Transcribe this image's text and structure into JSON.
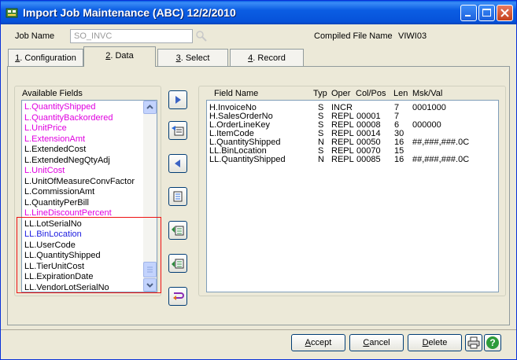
{
  "window": {
    "title": "Import Job Maintenance (ABC) 12/2/2010"
  },
  "header": {
    "job_name_label": "Job Name",
    "job_name_value": "SO_INVC",
    "compiled_label": "Compiled File Name",
    "compiled_value": "VIWI03"
  },
  "tabs": [
    {
      "key": "1",
      "rest": ". Configuration"
    },
    {
      "key": "2",
      "rest": ". Data"
    },
    {
      "key": "3",
      "rest": ". Select"
    },
    {
      "key": "4",
      "rest": ". Record"
    }
  ],
  "available": {
    "header": "Available Fields",
    "items": [
      {
        "label": "L.QuantityShipped",
        "color": "#E000E0"
      },
      {
        "label": "L.QuantityBackordered",
        "color": "#E000E0"
      },
      {
        "label": "L.UnitPrice",
        "color": "#E000E0"
      },
      {
        "label": "L.ExtensionAmt",
        "color": "#E000E0"
      },
      {
        "label": "L.ExtendedCost",
        "color": "#000000"
      },
      {
        "label": "L.ExtendedNegQtyAdj",
        "color": "#000000"
      },
      {
        "label": "L.UnitCost",
        "color": "#E000E0"
      },
      {
        "label": "L.UnitOfMeasureConvFactor",
        "color": "#000000"
      },
      {
        "label": "L.CommissionAmt",
        "color": "#000000"
      },
      {
        "label": "L.QuantityPerBill",
        "color": "#000000"
      },
      {
        "label": "L.LineDiscountPercent",
        "color": "#E000E0"
      },
      {
        "label": "LL.LotSerialNo",
        "color": "#000000"
      },
      {
        "label": "LL.BinLocation",
        "color": "#1C1CE0"
      },
      {
        "label": "LL.UserCode",
        "color": "#000000"
      },
      {
        "label": "LL.QuantityShipped",
        "color": "#000000"
      },
      {
        "label": "LL.TierUnitCost",
        "color": "#000000"
      },
      {
        "label": "LL.ExpirationDate",
        "color": "#000000"
      },
      {
        "label": "LL.VendorLotSerialNo",
        "color": "#000000"
      }
    ]
  },
  "fields_grid": {
    "columns": [
      "Field Name",
      "Typ",
      "Oper",
      "Col/Pos",
      "Len",
      "Msk/Val"
    ],
    "rows": [
      {
        "name": "H.InvoiceNo",
        "typ": "S",
        "oper": "INCR",
        "pos": "",
        "len": "7",
        "msk": "0001000"
      },
      {
        "name": "H.SalesOrderNo",
        "typ": "S",
        "oper": "REPL",
        "pos": "00001",
        "len": "7",
        "msk": ""
      },
      {
        "name": "L.OrderLineKey",
        "typ": "S",
        "oper": "REPL",
        "pos": "00008",
        "len": "6",
        "msk": "000000"
      },
      {
        "name": "L.ItemCode",
        "typ": "S",
        "oper": "REPL",
        "pos": "00014",
        "len": "30",
        "msk": ""
      },
      {
        "name": "L.QuantityShipped",
        "typ": "N",
        "oper": "REPL",
        "pos": "00050",
        "len": "16",
        "msk": "##,###,###.0C"
      },
      {
        "name": "LL.BinLocation",
        "typ": "S",
        "oper": "REPL",
        "pos": "00070",
        "len": "15",
        "msk": ""
      },
      {
        "name": "LL.QuantityShipped",
        "typ": "N",
        "oper": "REPL",
        "pos": "00085",
        "len": "16",
        "msk": "##,###,###.0C"
      }
    ]
  },
  "buttons": {
    "accept_key": "A",
    "accept_rest": "ccept",
    "cancel_key": "C",
    "cancel_rest": "ancel",
    "delete_key": "D",
    "delete_rest": "elete"
  }
}
